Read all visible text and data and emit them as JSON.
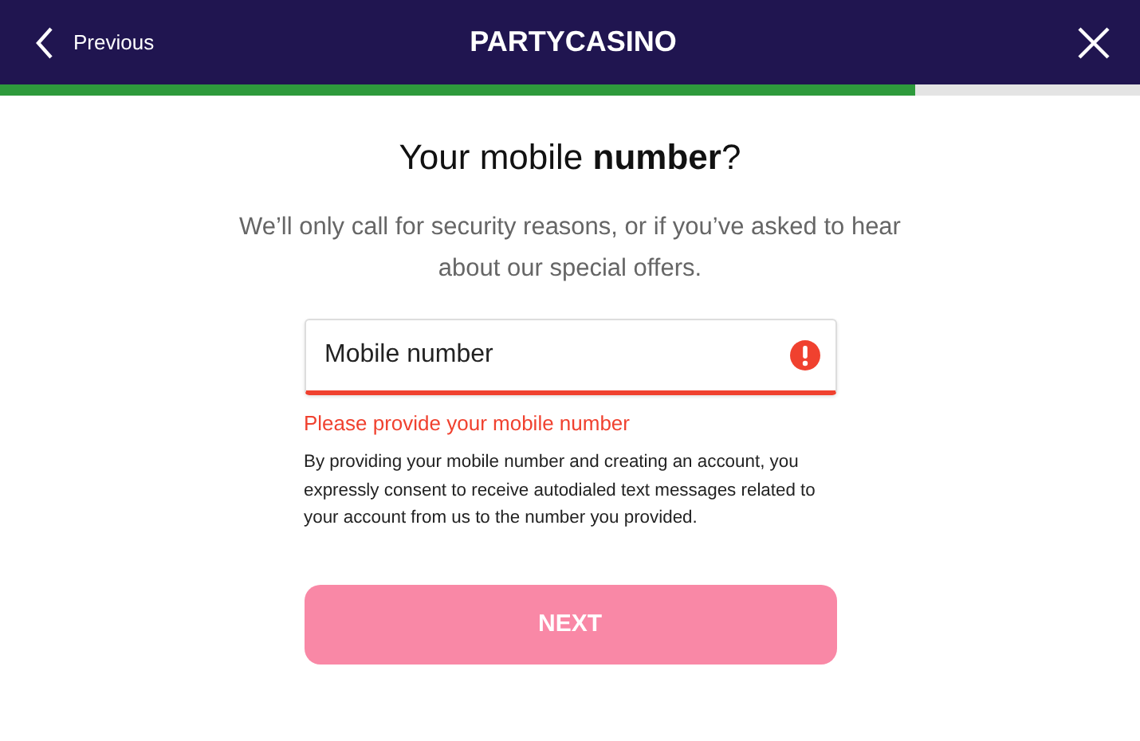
{
  "header": {
    "back_label": "Previous",
    "logo": "PARTYCASINO"
  },
  "progress": {
    "level": 0.803
  },
  "title": "Your mobile **number**?",
  "subtitle": "We’ll only call for security reasons, or if you’ve asked to hear about our special offers.",
  "phone_field": {
    "placeholder": "Mobile number",
    "error": true,
    "error_text": "Please provide your mobile number"
  },
  "consent_text": "By providing your mobile number and creating an account, you expressly consent to receive autodialed text messages related to your account from us to the number you provided.",
  "next_button": {
    "label": "NEXT",
    "disabled": true
  }
}
